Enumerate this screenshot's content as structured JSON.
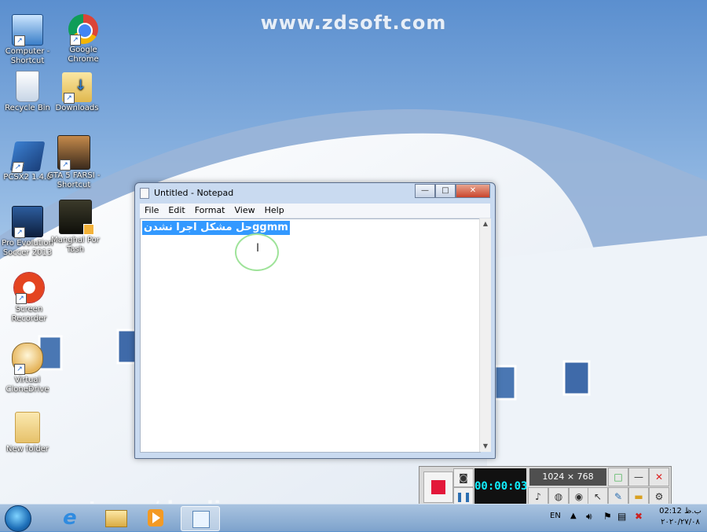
{
  "desktop": {
    "watermark_top": "www.zdsoft.com",
    "watermark_bottom": "aparat.com/dasdiv",
    "icons": [
      {
        "label": "Computer - Shortcut",
        "icon": "computer-icon"
      },
      {
        "label": "Google Chrome",
        "icon": "chrome-icon"
      },
      {
        "label": "Recycle Bin",
        "icon": "recycle-bin-icon"
      },
      {
        "label": "Downloads",
        "icon": "downloads-folder-icon"
      },
      {
        "label": "PCSX2 1.4.0",
        "icon": "pcsx2-icon"
      },
      {
        "label": "GTA 5 FARSI - Shortcut",
        "icon": "gta-icon"
      },
      {
        "label": "Pro Evolution Soccer 2013",
        "icon": "pes-icon"
      },
      {
        "label": "Manghal Por Tash",
        "icon": "video-file-icon"
      },
      {
        "label": "Screen Recorder",
        "icon": "screen-recorder-icon"
      },
      {
        "label": "Virtual CloneDrive",
        "icon": "virtual-clonedrive-icon"
      },
      {
        "label": "New folder",
        "icon": "folder-icon"
      }
    ]
  },
  "notepad": {
    "title": "Untitled - Notepad",
    "menu": [
      "File",
      "Edit",
      "Format",
      "View",
      "Help"
    ],
    "selected_text": "حل مشکل اجرا نشدنggmm",
    "buttons": {
      "minimize": "—",
      "maximize": "□",
      "close": "✕"
    }
  },
  "recorder": {
    "timer": "00:00:03",
    "resolution": "1024 × 768"
  },
  "taskbar": {
    "language": "EN",
    "time": "02:12 ب.ظ",
    "date": "۲۰۲۰/۲۷/۰۸"
  }
}
